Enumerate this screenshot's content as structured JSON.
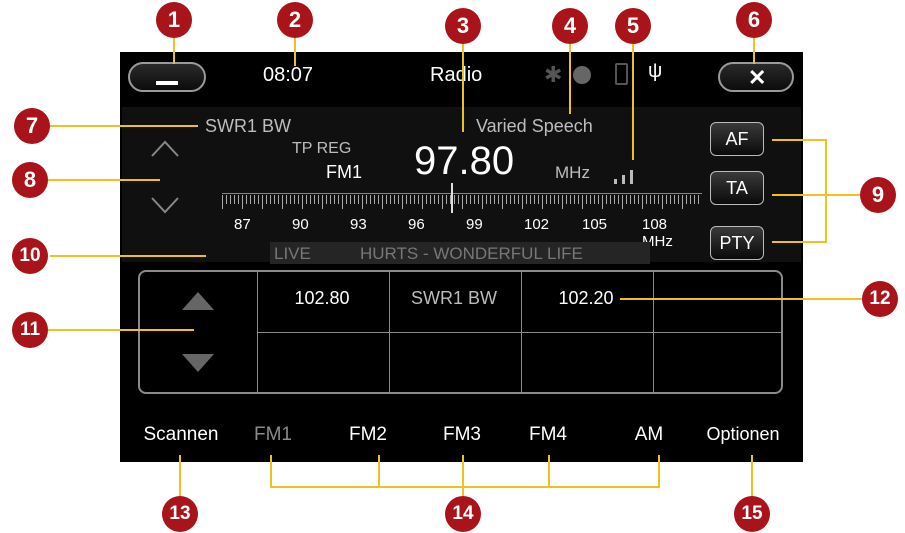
{
  "status": {
    "time": "08:07",
    "title": "Radio"
  },
  "station": {
    "name": "SWR1 BW",
    "pty_text": "Varied Speech",
    "tp_reg": "TP REG",
    "band": "FM1",
    "frequency": "97.80",
    "unit": "MHz"
  },
  "radiotext": {
    "live": "LIVE",
    "song": "HURTS - WONDERFUL LIFE"
  },
  "scale_labels": [
    "87",
    "90",
    "93",
    "96",
    "99",
    "102",
    "105",
    "108 MHz"
  ],
  "side_buttons": [
    "AF",
    "TA",
    "PTY"
  ],
  "presets": [
    [
      "102.80",
      "SWR1 BW",
      "102.20",
      ""
    ],
    [
      "",
      "",
      "",
      ""
    ]
  ],
  "bottom_tabs": [
    "Scannen",
    "FM1",
    "FM2",
    "FM3",
    "FM4",
    "AM",
    "Optionen"
  ],
  "callouts": [
    "1",
    "2",
    "3",
    "4",
    "5",
    "6",
    "7",
    "8",
    "9",
    "10",
    "11",
    "12",
    "13",
    "14",
    "15"
  ],
  "colors": {
    "callout": "#a8141a",
    "leader": "#f0c020",
    "accent_dim": "#a0a0a0"
  }
}
